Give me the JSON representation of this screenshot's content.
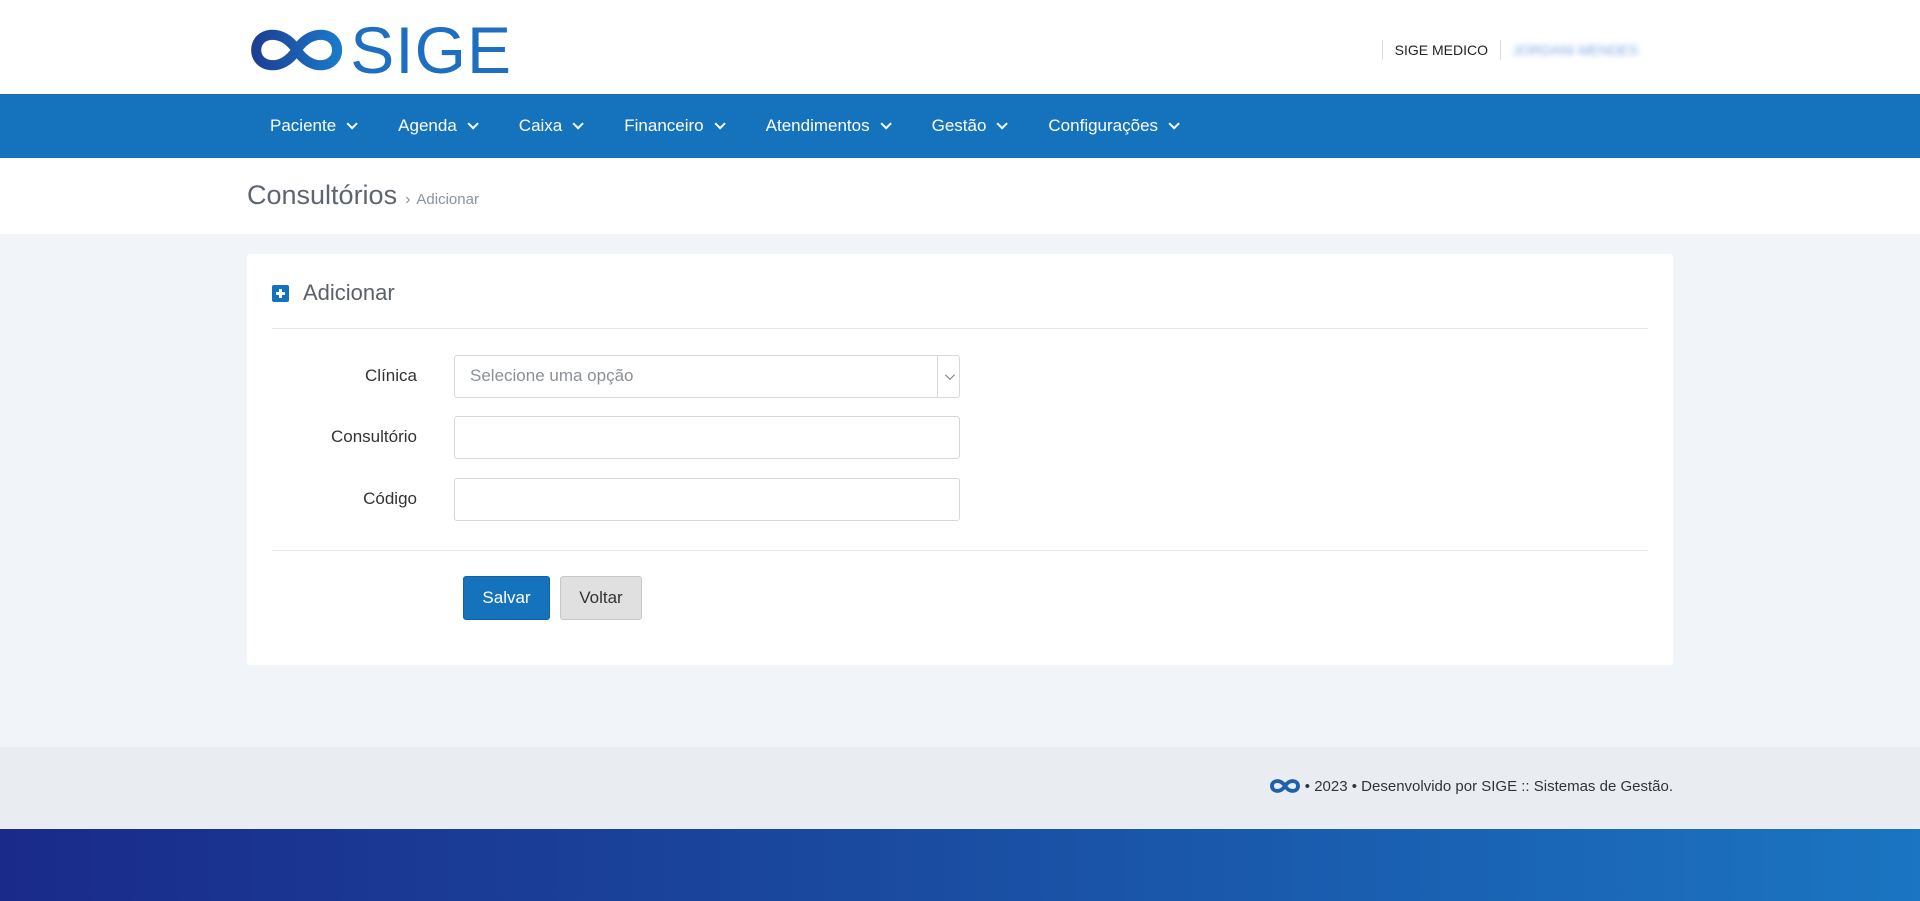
{
  "header": {
    "logo_text": "SIGE",
    "org_name": "SIGE MEDICO",
    "user_name": "JORDANI MENDES"
  },
  "nav": {
    "items": [
      {
        "label": "Paciente"
      },
      {
        "label": "Agenda"
      },
      {
        "label": "Caixa"
      },
      {
        "label": "Financeiro"
      },
      {
        "label": "Atendimentos"
      },
      {
        "label": "Gestão"
      },
      {
        "label": "Configurações"
      }
    ]
  },
  "breadcrumb": {
    "title": "Consultórios",
    "separator": "›",
    "current": "Adicionar"
  },
  "form": {
    "heading": "Adicionar",
    "fields": {
      "clinica": {
        "label": "Clínica",
        "placeholder": "Selecione uma opção",
        "value": ""
      },
      "consultorio": {
        "label": "Consultório",
        "value": ""
      },
      "codigo": {
        "label": "Código",
        "value": ""
      }
    },
    "save_label": "Salvar",
    "back_label": "Voltar"
  },
  "footer": {
    "text": "• 2023 • Desenvolvido por SIGE :: Sistemas de Gestão."
  },
  "colors": {
    "primary": "#1573be",
    "background": "#f1f4f8"
  },
  "icons": {
    "logo": "infinity-logo-icon",
    "add": "plus-square-icon",
    "dropdown": "chevron-down-icon"
  }
}
